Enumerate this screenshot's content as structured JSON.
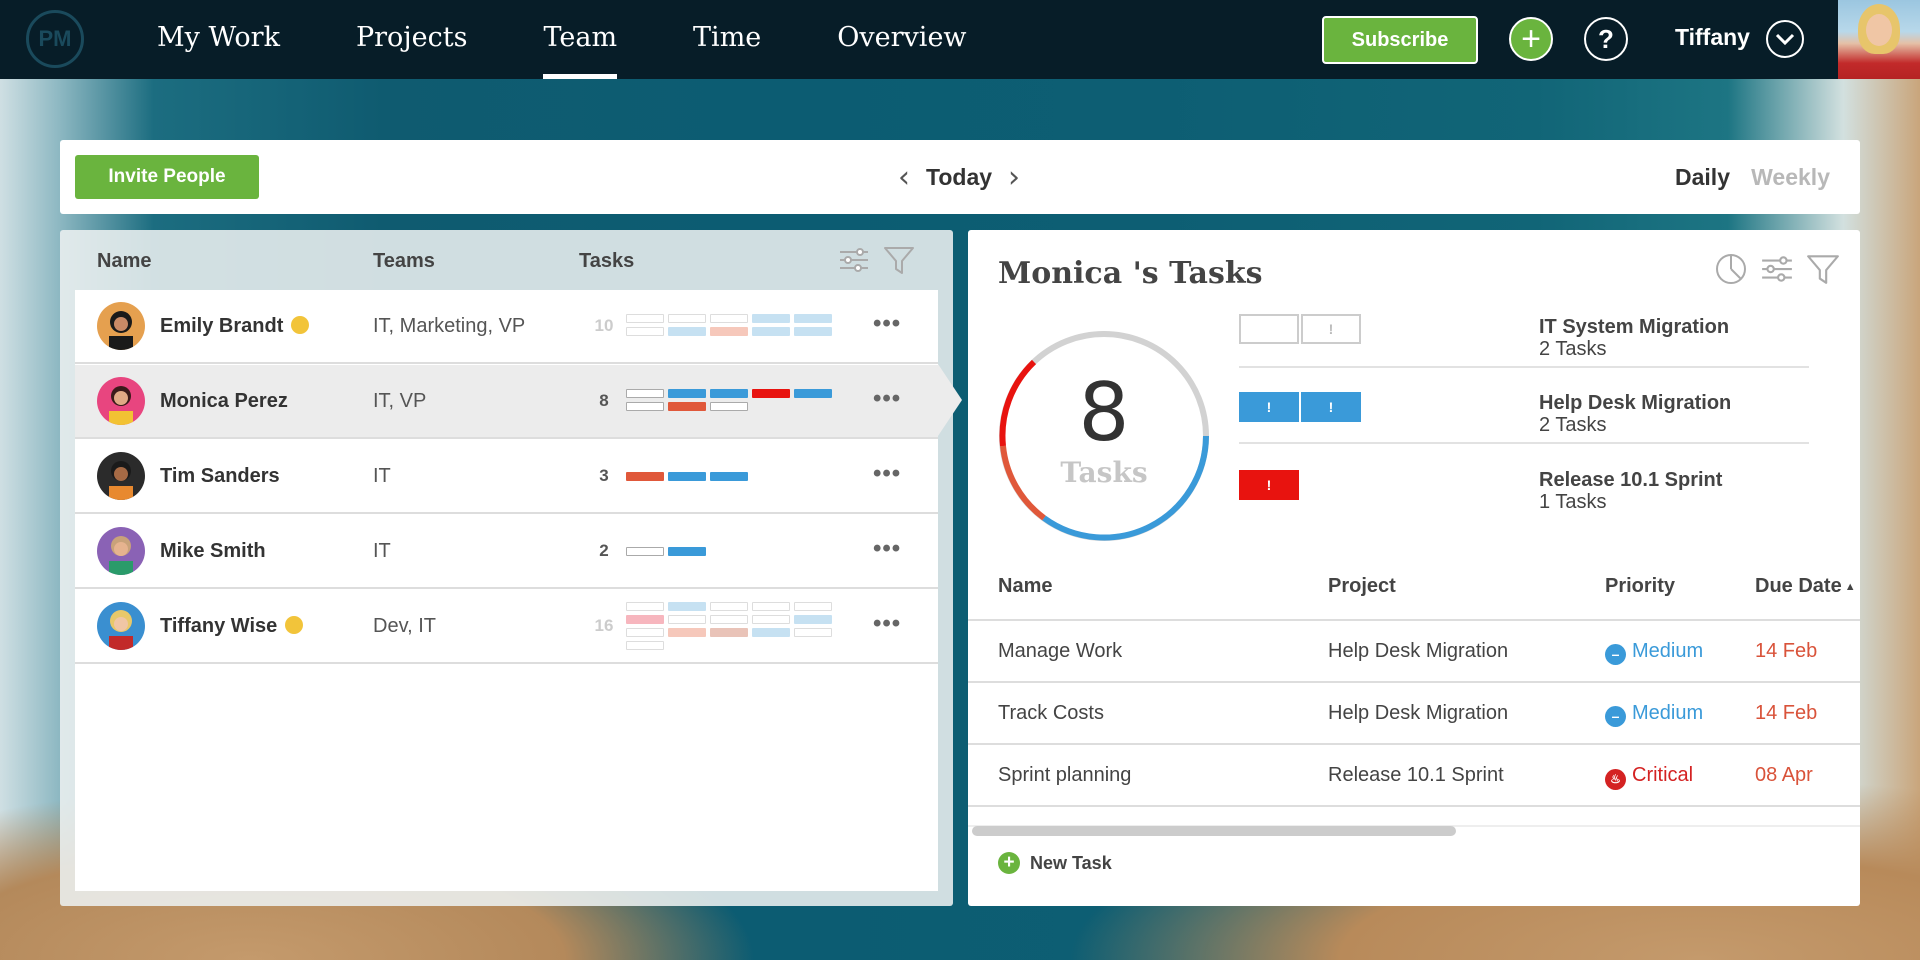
{
  "nav": {
    "logo": "PM",
    "items": [
      "My Work",
      "Projects",
      "Team",
      "Time",
      "Overview"
    ],
    "active": "Team",
    "subscribe": "Subscribe",
    "add_glyph": "+",
    "help_glyph": "?",
    "user": "Tiffany",
    "user_menu_glyph": "⌄"
  },
  "toolbar": {
    "invite": "Invite People",
    "prev_glyph": "‹",
    "today": "Today",
    "next_glyph": "›",
    "daily": "Daily",
    "weekly": "Weekly"
  },
  "team": {
    "columns": [
      "Name",
      "Teams",
      "Tasks"
    ],
    "more_glyph": "•••",
    "members": [
      {
        "name": "Emily Brandt",
        "teams": "IT, Marketing, VP",
        "tasks": "10",
        "online": true,
        "faded": true
      },
      {
        "name": "Monica Perez",
        "teams": "IT, VP",
        "tasks": "8",
        "online": false,
        "faded": false
      },
      {
        "name": "Tim Sanders",
        "teams": "IT",
        "tasks": "3",
        "online": false,
        "faded": false
      },
      {
        "name": "Mike Smith",
        "teams": "IT",
        "tasks": "2",
        "online": false,
        "faded": false
      },
      {
        "name": "Tiffany Wise",
        "teams": "Dev, IT",
        "tasks": "16",
        "online": true,
        "faded": true
      }
    ]
  },
  "detail": {
    "title": "Monica 's Tasks",
    "total": "8",
    "total_label": "Tasks",
    "chip_glyph": "!",
    "projects": [
      {
        "name": "IT System Migration",
        "count": "2 Tasks"
      },
      {
        "name": "Help Desk Migration",
        "count": "2 Tasks"
      },
      {
        "name": "Release 10.1 Sprint",
        "count": "1 Tasks"
      }
    ],
    "columns": [
      "Name",
      "Project",
      "Priority",
      "Due Date"
    ],
    "sort_glyph": "▲",
    "tasks": [
      {
        "name": "Manage Work",
        "project": "Help Desk Migration",
        "priority": "Medium",
        "priority_glyph": "–",
        "due": "14 Feb"
      },
      {
        "name": "Track Costs",
        "project": "Help Desk Migration",
        "priority": "Medium",
        "priority_glyph": "–",
        "due": "14 Feb"
      },
      {
        "name": "Sprint planning",
        "project": "Release 10.1 Sprint",
        "priority": "Critical",
        "priority_glyph": "♨",
        "due": "08 Apr"
      }
    ],
    "new_task_glyph": "+",
    "new_task": "New Task"
  },
  "colors": {
    "accent_green": "#6ab43e",
    "blue": "#3a9ad9",
    "red": "#e8130f",
    "orange": "#e0583a",
    "medium": "#3a9ad9",
    "critical": "#d42222",
    "due": "#d9533a"
  }
}
